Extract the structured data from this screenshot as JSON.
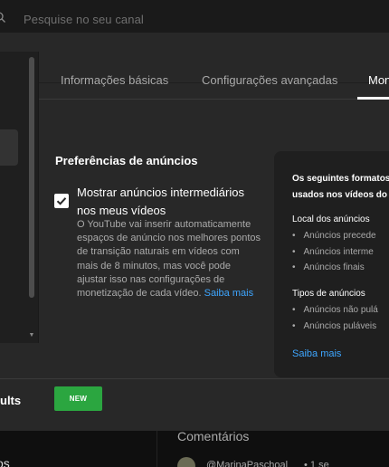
{
  "topbar": {
    "search_placeholder": "Pesquise no seu canal"
  },
  "tabs": [
    {
      "label": "Informações básicas"
    },
    {
      "label": "Configurações avançadas"
    },
    {
      "label": "Mon"
    }
  ],
  "ads": {
    "title": "Preferências de anúncios",
    "checkbox_label": "Mostrar anúncios intermediários nos meus vídeos",
    "checkbox_checked": true,
    "description": "O YouTube vai inserir automaticamente espaços de anúncio nos melhores pontos de transição naturais em vídeos com mais de 8 minutos, mas você pode ajustar isso nas configurações de monetização de cada vídeo.",
    "learn_more": "Saiba mais"
  },
  "info": {
    "intro_line1": "Os seguintes formatos",
    "intro_line2": "usados nos vídeos do c",
    "location_title": "Local dos anúncios",
    "location_items": [
      "Anúncios precede",
      "Anúncios interme",
      "Anúncios finais"
    ],
    "types_title": "Tipos de anúncios",
    "types_items": [
      "Anúncios não pulá",
      "Anúncios puláveis"
    ],
    "learn_more": "Saiba mais"
  },
  "footer": {
    "results_text": "ults",
    "new_button": "NEW"
  },
  "below": {
    "left_text": "os",
    "comments_title": "Comentários",
    "comment_author": "@MarinaPaschoal",
    "comment_time": "• 1 se"
  }
}
